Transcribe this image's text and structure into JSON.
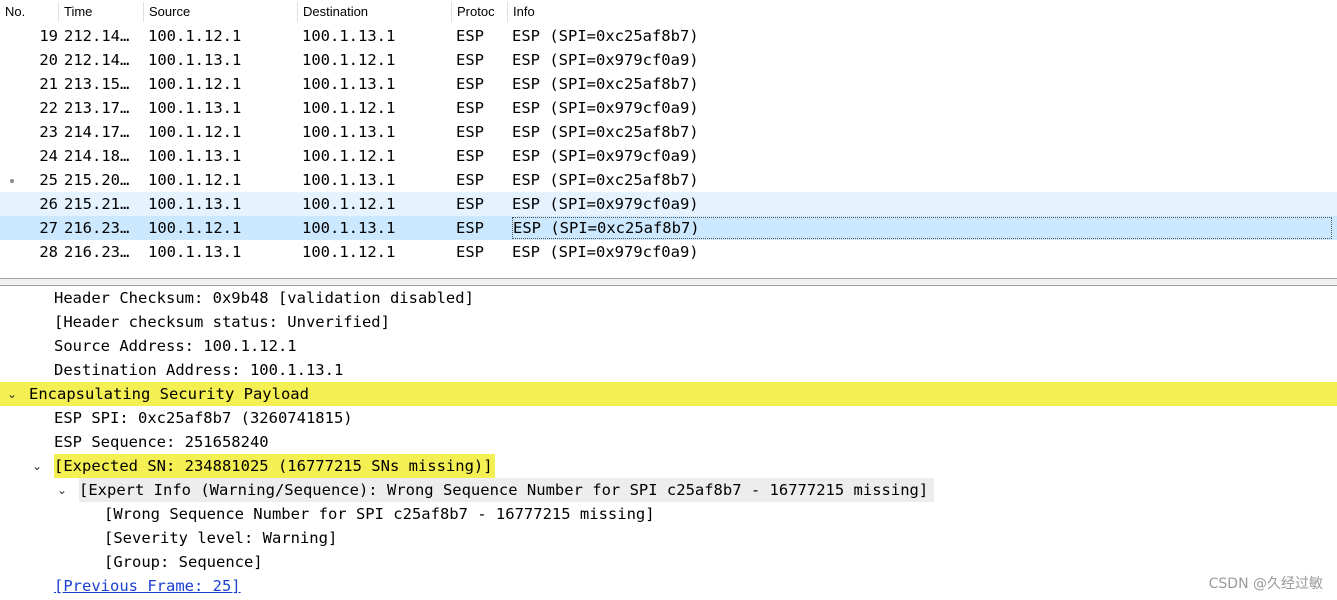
{
  "packet_list": {
    "columns": [
      "No.",
      "Time",
      "Source",
      "Destination",
      "Protoc",
      "Info"
    ],
    "rows": [
      {
        "no": "19",
        "time": "212.14…",
        "source": "100.1.12.1",
        "destination": "100.1.13.1",
        "protocol": "ESP",
        "info": "ESP (SPI=0xc25af8b7)"
      },
      {
        "no": "20",
        "time": "212.14…",
        "source": "100.1.13.1",
        "destination": "100.1.12.1",
        "protocol": "ESP",
        "info": "ESP (SPI=0x979cf0a9)"
      },
      {
        "no": "21",
        "time": "213.15…",
        "source": "100.1.12.1",
        "destination": "100.1.13.1",
        "protocol": "ESP",
        "info": "ESP (SPI=0xc25af8b7)"
      },
      {
        "no": "22",
        "time": "213.17…",
        "source": "100.1.13.1",
        "destination": "100.1.12.1",
        "protocol": "ESP",
        "info": "ESP (SPI=0x979cf0a9)"
      },
      {
        "no": "23",
        "time": "214.17…",
        "source": "100.1.12.1",
        "destination": "100.1.13.1",
        "protocol": "ESP",
        "info": "ESP (SPI=0xc25af8b7)"
      },
      {
        "no": "24",
        "time": "214.18…",
        "source": "100.1.13.1",
        "destination": "100.1.12.1",
        "protocol": "ESP",
        "info": "ESP (SPI=0x979cf0a9)"
      },
      {
        "no": "25",
        "time": "215.20…",
        "source": "100.1.12.1",
        "destination": "100.1.13.1",
        "protocol": "ESP",
        "info": "ESP (SPI=0xc25af8b7)"
      },
      {
        "no": "26",
        "time": "215.21…",
        "source": "100.1.13.1",
        "destination": "100.1.12.1",
        "protocol": "ESP",
        "info": "ESP (SPI=0x979cf0a9)"
      },
      {
        "no": "27",
        "time": "216.23…",
        "source": "100.1.12.1",
        "destination": "100.1.13.1",
        "protocol": "ESP",
        "info": "ESP (SPI=0xc25af8b7)"
      },
      {
        "no": "28",
        "time": "216.23…",
        "source": "100.1.13.1",
        "destination": "100.1.12.1",
        "protocol": "ESP",
        "info": "ESP (SPI=0x979cf0a9)"
      }
    ]
  },
  "details": {
    "lines": [
      "Header Checksum: 0x9b48 [validation disabled]",
      "[Header checksum status: Unverified]",
      "Source Address: 100.1.12.1",
      "Destination Address: 100.1.13.1",
      "Encapsulating Security Payload",
      "ESP SPI: 0xc25af8b7 (3260741815)",
      "ESP Sequence: 251658240",
      "[Expected SN: 234881025 (16777215 SNs missing)]",
      "[Expert Info (Warning/Sequence): Wrong Sequence Number for SPI c25af8b7 - 16777215 missing]",
      "[Wrong Sequence Number for SPI c25af8b7 - 16777215 missing]",
      "[Severity level: Warning]",
      "[Group: Sequence]",
      "[Previous Frame: 25]"
    ]
  },
  "watermark": "CSDN @久经过敏",
  "colors": {
    "selected_row": "#cce8ff",
    "hover_row": "#e5f3ff",
    "expert_highlight": "#f4ef52",
    "link": "#1a3fd1"
  }
}
